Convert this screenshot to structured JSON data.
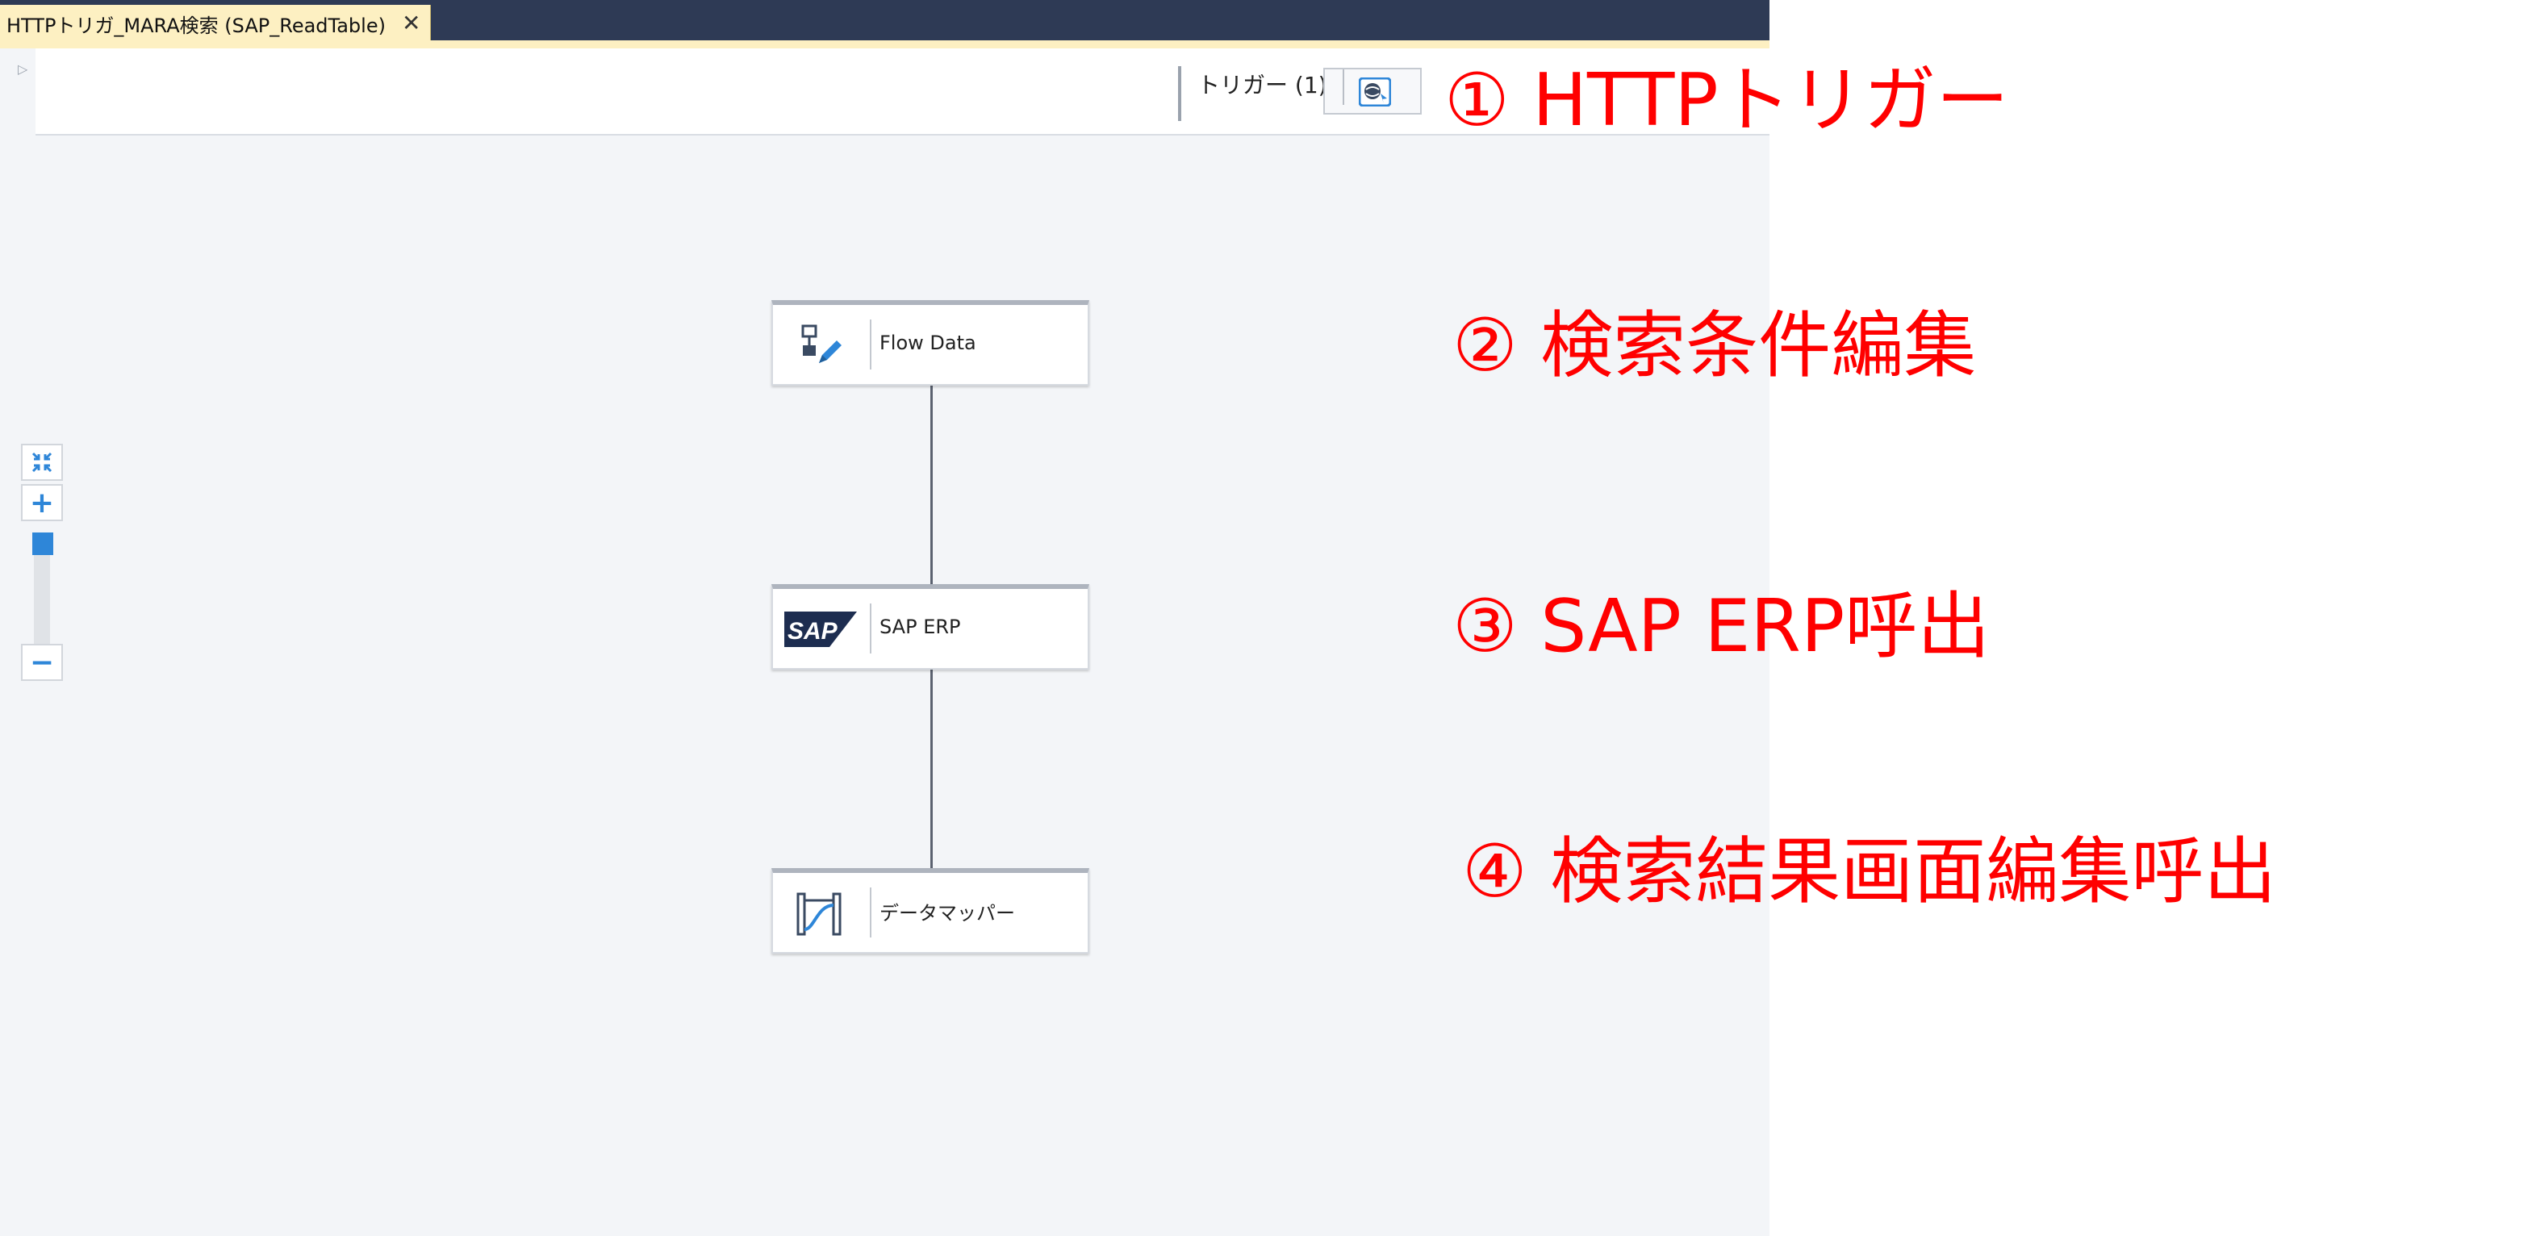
{
  "window": {
    "tab_title": "HTTPトリガ_MARA検索 (SAP_ReadTable)",
    "tab_close_glyph": "✕"
  },
  "toolbar": {
    "trigger_label": "トリガー (1)",
    "trigger_icon": "http-trigger-icon"
  },
  "zoom": {
    "fit_icon": "collapse-arrows-icon",
    "in_label": "+",
    "out_label": "−",
    "level_percent": 100
  },
  "flow": {
    "nodes": [
      {
        "label": "Flow Data",
        "icon": "flow-data-edit-icon"
      },
      {
        "label": "SAP ERP",
        "icon": "sap-logo-icon",
        "logo_text": "SAP"
      },
      {
        "label": "データマッパー",
        "icon": "data-mapper-icon"
      }
    ]
  },
  "annotations": [
    "① HTTPトリガー",
    "② 検索条件編集",
    "③ SAP ERP呼出",
    "④ 検索結果画面編集呼出"
  ],
  "colors": {
    "annotation": "#ff0000",
    "accent_blue": "#2e86d8",
    "title_bar": "#2e3a55",
    "tab_bg": "#fdf0c2",
    "canvas_bg": "#f3f5f8"
  }
}
